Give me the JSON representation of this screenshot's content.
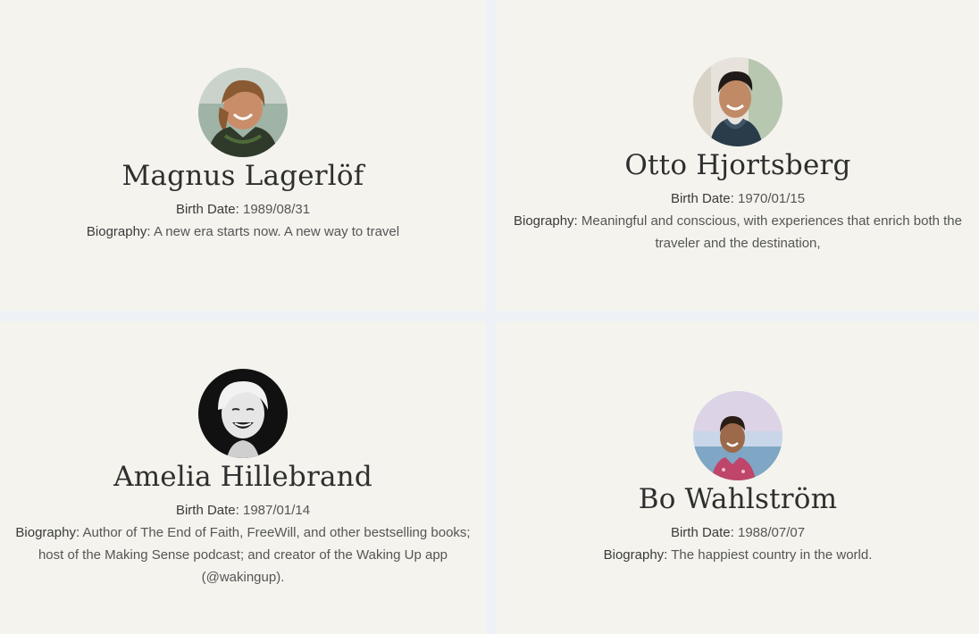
{
  "profiles": [
    {
      "name": "Magnus Lagerlöf",
      "birth_label": "Birth Date:",
      "birth_date": "1989/08/31",
      "bio_label": "Biography:",
      "biography": "A new era starts now. A new way to travel",
      "avatar_icon": "portrait-laughing-man-icon"
    },
    {
      "name": "Otto Hjortsberg",
      "birth_label": "Birth Date:",
      "birth_date": "1970/01/15",
      "bio_label": "Biography:",
      "biography": "Meaningful and conscious, with experiences that enrich both the traveler and the destination,",
      "avatar_icon": "portrait-smiling-man-icon"
    },
    {
      "name": "Amelia Hillebrand",
      "birth_label": "Birth Date:",
      "birth_date": "1987/01/14",
      "bio_label": "Biography:",
      "biography": "Author of The End of Faith, FreeWill, and other bestselling books; host of the Making Sense podcast; and creator of the Waking Up app (@wakingup).",
      "avatar_icon": "portrait-laughing-woman-icon"
    },
    {
      "name": "Bo Wahlström",
      "birth_label": "Birth Date:",
      "birth_date": "1988/07/07",
      "bio_label": "Biography:",
      "biography": "The happiest country in the world.",
      "avatar_icon": "portrait-beach-man-icon"
    }
  ],
  "colors": {
    "page_background": "#eef2f6",
    "card_background": "#f4f3ee",
    "name_text": "#2e2e2e",
    "body_text": "#555555"
  }
}
